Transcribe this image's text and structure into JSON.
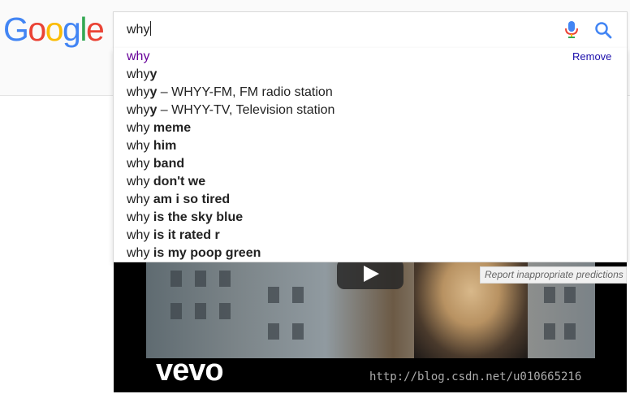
{
  "logo": {
    "letters": [
      "G",
      "o",
      "o",
      "g",
      "l",
      "e"
    ],
    "colors": [
      "#4285f4",
      "#ea4335",
      "#fbbc05",
      "#4285f4",
      "#34a853",
      "#ea4335"
    ]
  },
  "search": {
    "value": "why",
    "mic_icon": "microphone-icon",
    "search_icon": "magnifier-icon"
  },
  "suggestions": [
    {
      "prefix": "why",
      "bold": "",
      "rest": "",
      "visited": true
    },
    {
      "prefix": "why",
      "bold": "y",
      "rest": ""
    },
    {
      "prefix": "why",
      "bold": "y",
      "rest": " – WHYY-FM, FM radio station"
    },
    {
      "prefix": "why",
      "bold": "y",
      "rest": " – WHYY-TV, Television station"
    },
    {
      "prefix": "why ",
      "bold": "meme",
      "rest": ""
    },
    {
      "prefix": "why ",
      "bold": "him",
      "rest": ""
    },
    {
      "prefix": "why ",
      "bold": "band",
      "rest": ""
    },
    {
      "prefix": "why ",
      "bold": "don't we",
      "rest": ""
    },
    {
      "prefix": "why ",
      "bold": "am i so tired",
      "rest": ""
    },
    {
      "prefix": "why ",
      "bold": "is the sky blue",
      "rest": ""
    },
    {
      "prefix": "why ",
      "bold": "is it rated r",
      "rest": ""
    },
    {
      "prefix": "why ",
      "bold": "is my poop green",
      "rest": ""
    }
  ],
  "remove_label": "Remove",
  "report_label": "Report inappropriate predictions",
  "video": {
    "brand": "vevo"
  },
  "watermark": "http://blog.csdn.net/u010665216",
  "colors": {
    "visited": "#660099",
    "link": "#1a0dab"
  }
}
